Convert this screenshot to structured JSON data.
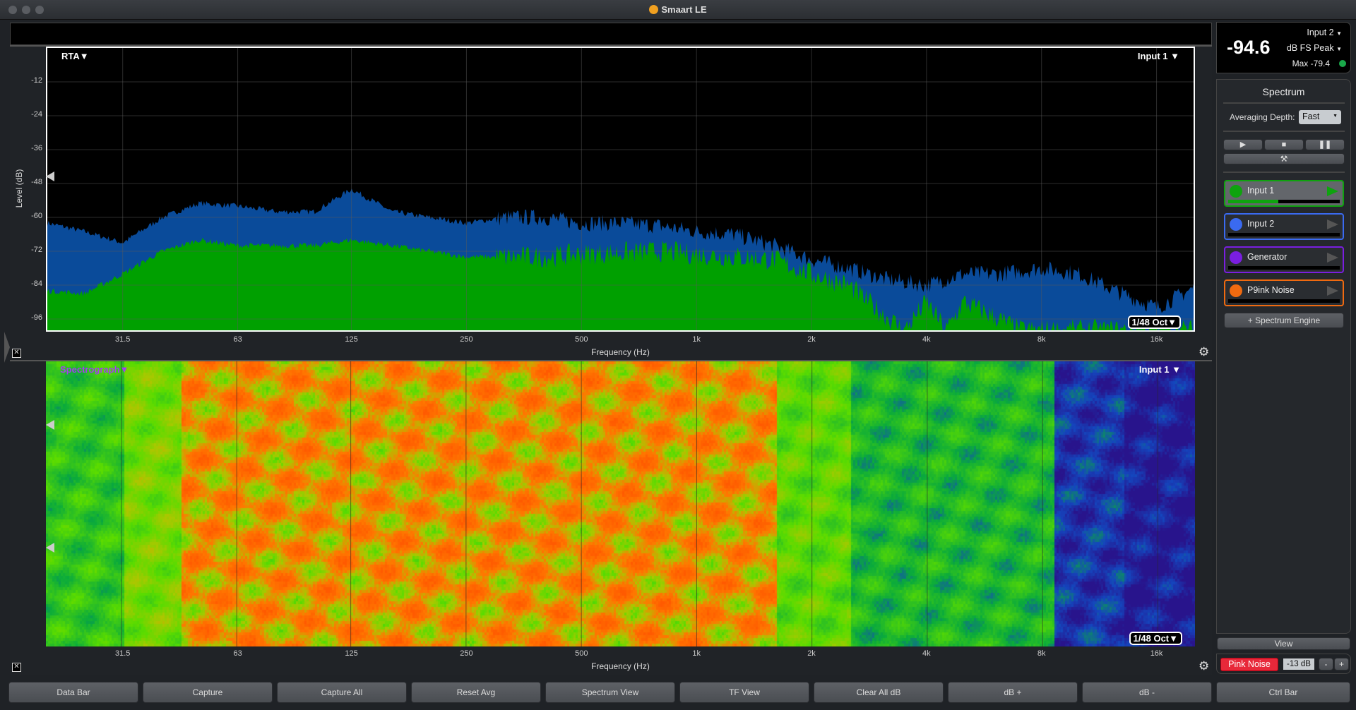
{
  "window": {
    "title": "Smaart LE"
  },
  "rta": {
    "title": "RTA▼",
    "source": "Input 1 ▼",
    "resolution": "1/48 Oct▼",
    "ylabel": "Level (dB)",
    "xlabel": "Frequency (Hz)",
    "yticks": [
      "-12",
      "-24",
      "-36",
      "-48",
      "-60",
      "-72",
      "-84",
      "-96"
    ],
    "xticks": [
      "31.5",
      "63",
      "125",
      "250",
      "500",
      "1k",
      "2k",
      "4k",
      "8k",
      "16k"
    ]
  },
  "spectrograph": {
    "title": "Spectrograph▼",
    "source": "Input 1 ▼",
    "resolution": "1/48 Oct▼",
    "xlabel": "Frequency (Hz)"
  },
  "chart_data": {
    "type": "area",
    "xscale": "log",
    "xlim": [
      20,
      20000
    ],
    "ylim": [
      -100,
      0
    ],
    "grid": true,
    "xlabel": "Frequency (Hz)",
    "ylabel": "Level (dB)",
    "series": [
      {
        "color": "#0a4b9a",
        "points": [
          [
            20,
            -62
          ],
          [
            25,
            -65
          ],
          [
            31.5,
            -69
          ],
          [
            40,
            -60
          ],
          [
            50,
            -55
          ],
          [
            63,
            -56
          ],
          [
            80,
            -58
          ],
          [
            100,
            -58
          ],
          [
            125,
            -50
          ],
          [
            160,
            -58
          ],
          [
            200,
            -60
          ],
          [
            250,
            -62
          ],
          [
            315,
            -60
          ],
          [
            400,
            -60
          ],
          [
            500,
            -62
          ],
          [
            630,
            -62
          ],
          [
            800,
            -63
          ],
          [
            1000,
            -65
          ],
          [
            1250,
            -66
          ],
          [
            1600,
            -70
          ],
          [
            2000,
            -75
          ],
          [
            2500,
            -78
          ],
          [
            3150,
            -82
          ],
          [
            4000,
            -84
          ],
          [
            5000,
            -80
          ],
          [
            6300,
            -80
          ],
          [
            8000,
            -78
          ],
          [
            10000,
            -80
          ],
          [
            12500,
            -86
          ],
          [
            16000,
            -92
          ],
          [
            20000,
            -85
          ]
        ]
      },
      {
        "color": "#00a000",
        "points": [
          [
            20,
            -86
          ],
          [
            25,
            -87
          ],
          [
            31.5,
            -80
          ],
          [
            40,
            -72
          ],
          [
            50,
            -68
          ],
          [
            63,
            -70
          ],
          [
            80,
            -70
          ],
          [
            100,
            -70
          ],
          [
            125,
            -68
          ],
          [
            160,
            -70
          ],
          [
            200,
            -72
          ],
          [
            250,
            -74
          ],
          [
            400,
            -74
          ],
          [
            500,
            -73
          ],
          [
            800,
            -72
          ],
          [
            1000,
            -73
          ],
          [
            1600,
            -75
          ],
          [
            2000,
            -80
          ],
          [
            2500,
            -84
          ],
          [
            3000,
            -93
          ],
          [
            3500,
            -100
          ],
          [
            4000,
            -90
          ],
          [
            4500,
            -100
          ],
          [
            5000,
            -90
          ],
          [
            6000,
            -95
          ],
          [
            7000,
            -100
          ],
          [
            20000,
            -100
          ]
        ]
      }
    ]
  },
  "meter": {
    "value": "-94.6",
    "source": "Input 2",
    "mode": "dB FS Peak",
    "max": "Max -79.4",
    "status_color": "#1aa84a"
  },
  "spectrum_panel": {
    "title": "Spectrum",
    "averaging_label": "Averaging Depth:",
    "averaging_value": "Fast",
    "engines": [
      {
        "name": "Input 1",
        "color": "#0ea30e",
        "active": true,
        "level": 0.45
      },
      {
        "name": "Input 2",
        "color": "#3a6af0",
        "active": false,
        "level": 0
      },
      {
        "name": "Generator",
        "color": "#7a1ee0",
        "active": false,
        "level": 0
      },
      {
        "name": "P9ink Noise",
        "color": "#f06a10",
        "active": false,
        "level": 0
      }
    ],
    "add_engine": "+ Spectrum Engine"
  },
  "view_label": "View",
  "generator": {
    "label": "Pink Noise",
    "level": "-13 dB",
    "minus": "-",
    "plus": "+"
  },
  "bottom_buttons": [
    "Data Bar",
    "Capture",
    "Capture All",
    "Reset Avg",
    "Spectrum View",
    "TF View",
    "Clear All dB",
    "dB +",
    "dB -",
    "Ctrl Bar"
  ]
}
